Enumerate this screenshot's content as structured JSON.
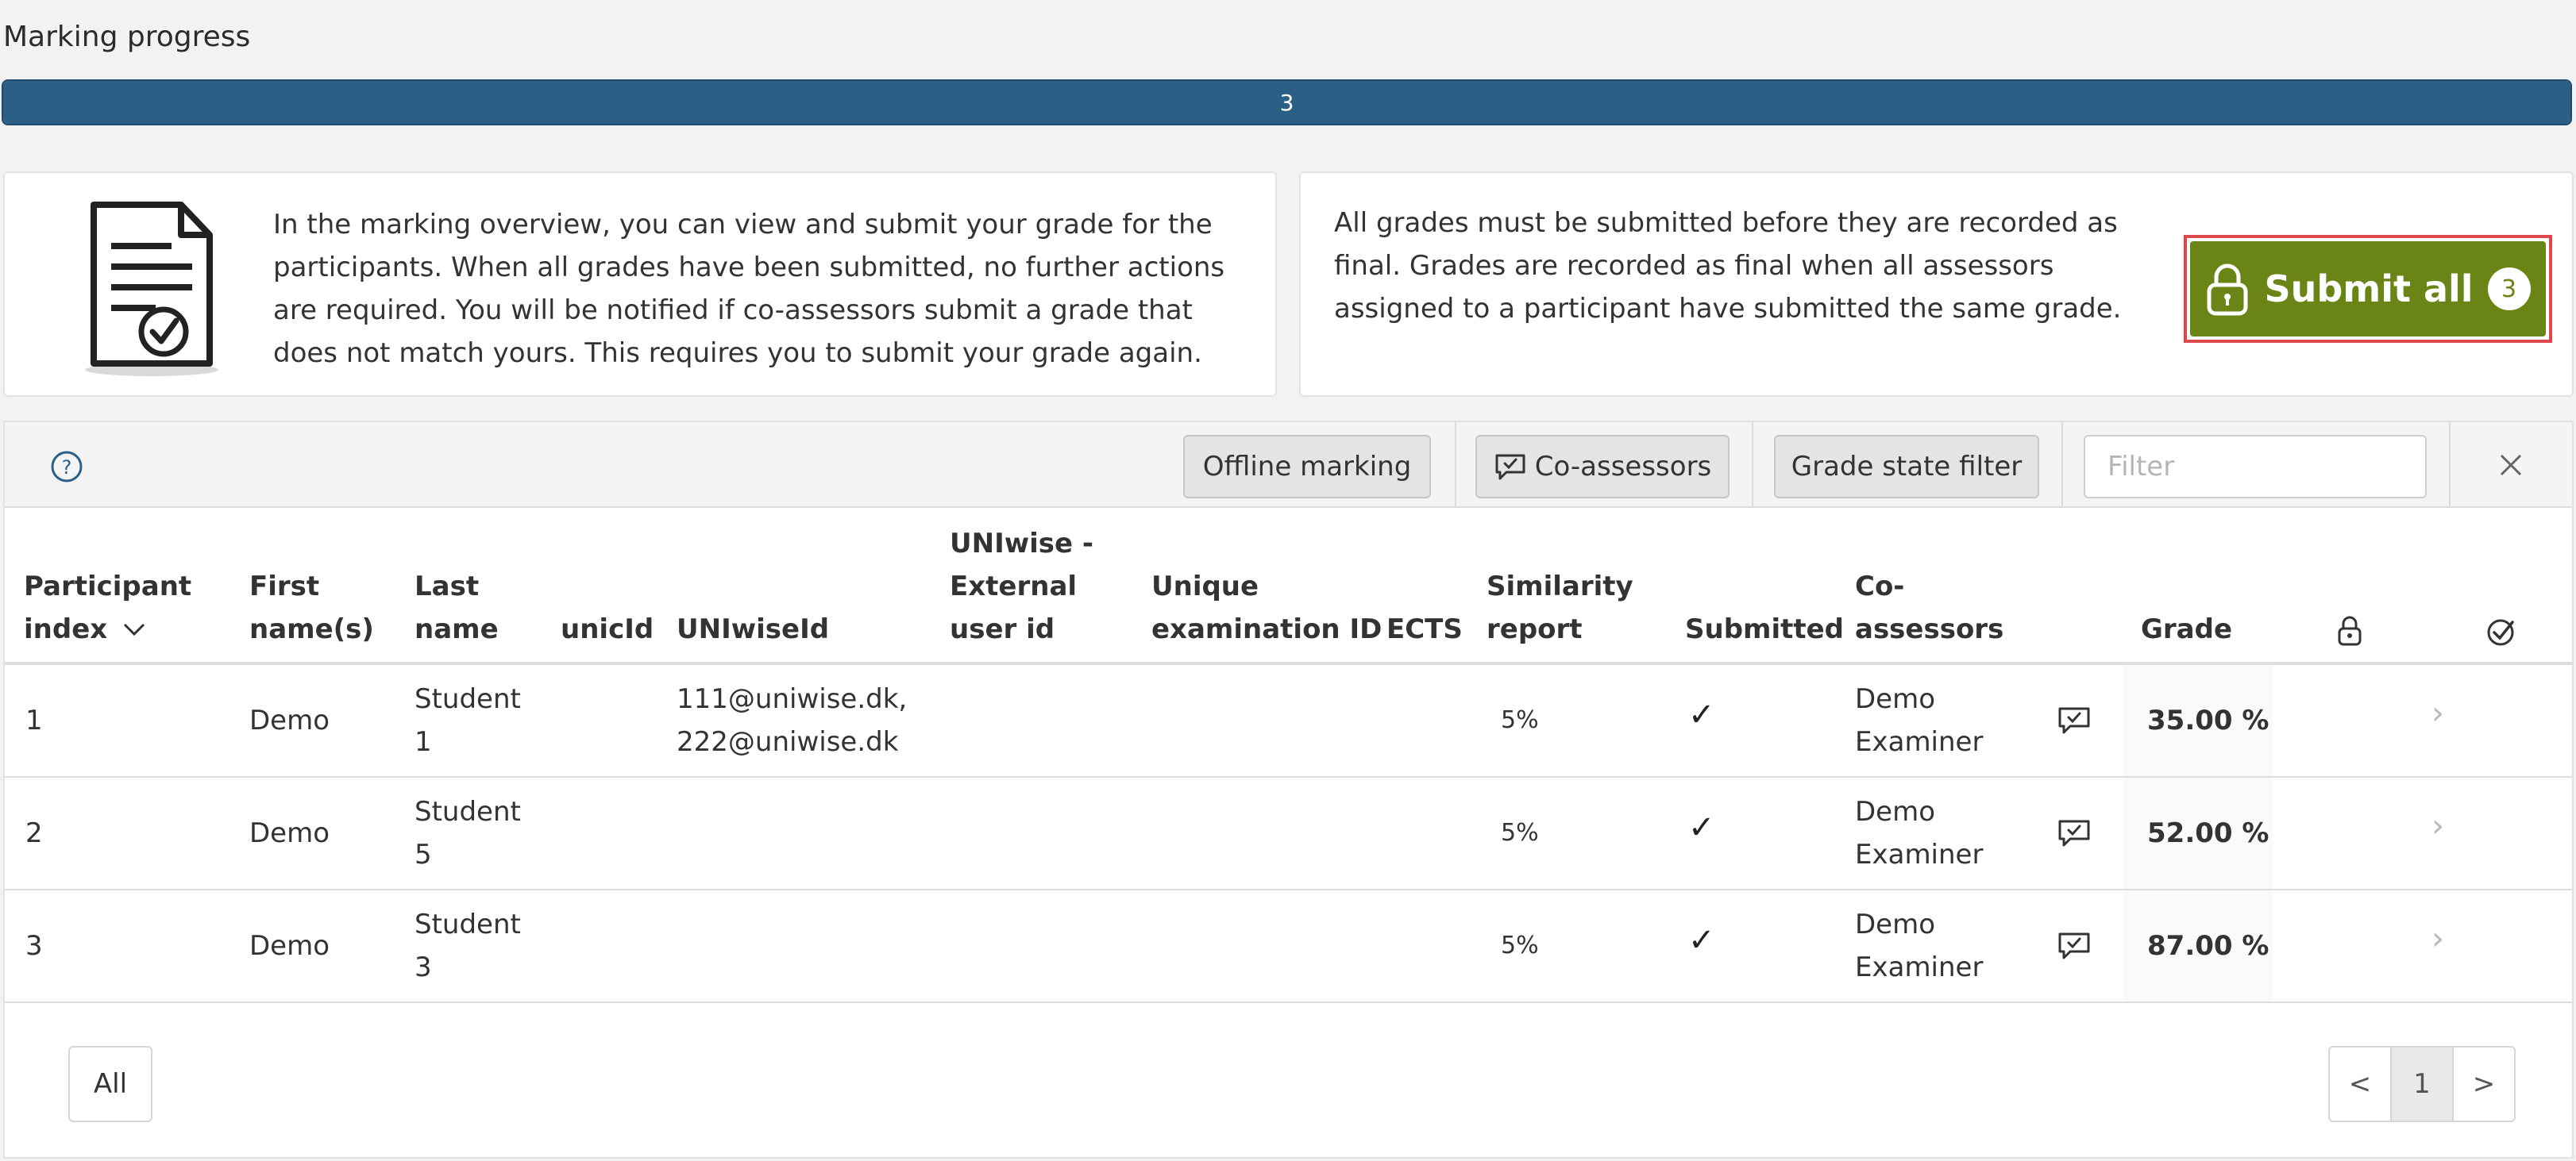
{
  "progress": {
    "title": "Marking progress",
    "value_label": "3",
    "fraction": 1.0
  },
  "info": {
    "text": "In the marking overview, you can view and submit your grade for the participants. When all grades have been submitted, no further actions are required. You will be notified if co-assessors submit a grade that does not match yours. This requires you to submit your grade again.",
    "final_text": "All grades must be submitted before they are recorded as final. Grades are recorded as final when all assessors assigned to a participant have submitted the same grade."
  },
  "submit": {
    "label": "Submit all",
    "count": "3"
  },
  "toolbar": {
    "offline_label": "Offline marking",
    "coassessors_label": "Co-assessors",
    "grade_filter_label": "Grade state filter",
    "filter_placeholder": "Filter"
  },
  "table": {
    "headers": {
      "index_1": "Participant",
      "index_2": "index",
      "first_1": "First",
      "first_2": "name(s)",
      "last_1": "Last",
      "last_2": "name",
      "unicid": "unicId",
      "uniwiseid": "UNIwiseId",
      "ext_1": "UNIwise -",
      "ext_2": "External",
      "ext_3": "user id",
      "exam_1": "Unique",
      "exam_2": "examination ID",
      "ects": "ECTS",
      "sim_1": "Similarity",
      "sim_2": "report",
      "submitted": "Submitted",
      "co_1": "Co-",
      "co_2": "assessors",
      "grade": "Grade"
    },
    "rows": [
      {
        "index": "1",
        "first": "Demo",
        "last_1": "Student",
        "last_2": "1",
        "uniwise_1": "111@uniwise.dk,",
        "uniwise_2": "222@uniwise.dk",
        "similarity": "5%",
        "co_1": "Demo",
        "co_2": "Examiner",
        "grade": "35.00 %"
      },
      {
        "index": "2",
        "first": "Demo",
        "last_1": "Student",
        "last_2": "5",
        "uniwise_1": "",
        "uniwise_2": "",
        "similarity": "5%",
        "co_1": "Demo",
        "co_2": "Examiner",
        "grade": "52.00 %"
      },
      {
        "index": "3",
        "first": "Demo",
        "last_1": "Student",
        "last_2": "3",
        "uniwise_1": "",
        "uniwise_2": "",
        "similarity": "5%",
        "co_1": "Demo",
        "co_2": "Examiner",
        "grade": "87.00 %"
      }
    ]
  },
  "footer": {
    "all_label": "All",
    "prev": "<",
    "page": "1",
    "next": ">"
  },
  "colors": {
    "progress": "#2b5f85",
    "submit": "#6a8416",
    "highlight": "#e0474c"
  },
  "icons": [
    "document-check-icon",
    "lock-icon",
    "help-icon",
    "chat-check-icon",
    "check-circle-icon",
    "close-icon",
    "chevron-down-icon",
    "chevron-right-icon",
    "checkmark-icon"
  ]
}
